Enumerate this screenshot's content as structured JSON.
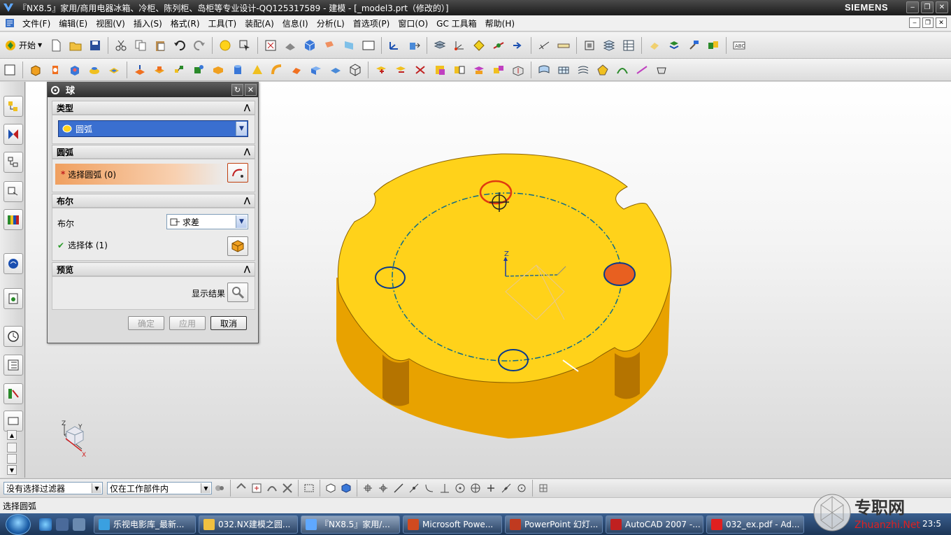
{
  "window": {
    "title": "『NX8.5』家用/商用电器冰箱、冷柜、陈列柜、岛柜等专业设计-QQ125317589 - 建模 - [_model3.prt（修改的）]",
    "brand": "SIEMENS"
  },
  "menu": {
    "items": [
      "文件(F)",
      "编辑(E)",
      "视图(V)",
      "插入(S)",
      "格式(R)",
      "工具(T)",
      "装配(A)",
      "信息(I)",
      "分析(L)",
      "首选项(P)",
      "窗口(O)",
      "GC 工具箱",
      "帮助(H)"
    ]
  },
  "toolbar": {
    "start_label": "开始"
  },
  "dialog": {
    "title": "球",
    "type_section": "类型",
    "type_value": "圆弧",
    "arc_section": "圆弧",
    "select_arc_label": "选择圆弧 (0)",
    "boolean_section": "布尔",
    "boolean_label": "布尔",
    "boolean_value": "求差",
    "select_body_label": "选择体 (1)",
    "preview_section": "预览",
    "show_result_label": "显示结果",
    "ok_label": "确定",
    "apply_label": "应用",
    "cancel_label": "取消"
  },
  "selection_bar": {
    "filter_value": "没有选择过滤器",
    "scope_value": "仅在工作部件内"
  },
  "status": {
    "prompt": "选择圆弧"
  },
  "taskbar": {
    "tasks": [
      {
        "label": "乐视电影库_最新..."
      },
      {
        "label": "032.NX建模之圆..."
      },
      {
        "label": "『NX8.5』家用/..."
      },
      {
        "label": "Microsoft Powe..."
      },
      {
        "label": "PowerPoint 幻灯..."
      },
      {
        "label": "AutoCAD 2007 -..."
      },
      {
        "label": "032_ex.pdf - Ad..."
      }
    ],
    "clock": "23:5"
  },
  "watermark": {
    "text": "专职网",
    "url": "Zhuanzhi.Net"
  },
  "view_triad": {
    "x_label": "X",
    "y_label": "Y",
    "z_label": "Z"
  },
  "colors": {
    "part_top": "#ffd21a",
    "part_side": "#e8a200",
    "curve": "#0a5a9a",
    "highlight": "#e03a10"
  }
}
